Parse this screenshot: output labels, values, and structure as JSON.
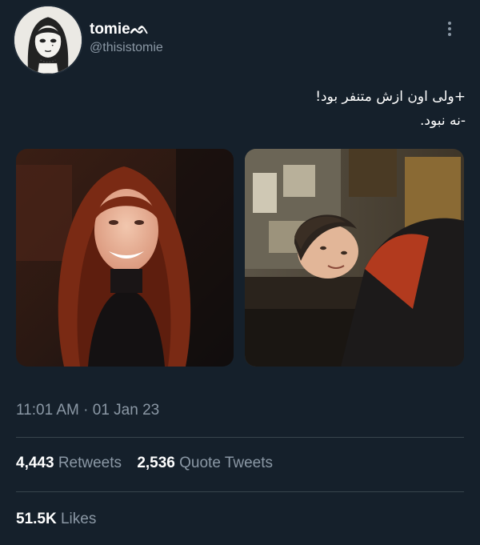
{
  "author": {
    "display_name": "tomie",
    "name_glyph": "ᨒ",
    "handle": "@thisistomie",
    "avatar_icon": "manga-portrait-avatar"
  },
  "tweet": {
    "lines": [
      "+ولی اون ازش متنفر بود!",
      "-نه نبود."
    ]
  },
  "media": [
    {
      "icon": "photo-woman-red-hair-smiling"
    },
    {
      "icon": "photo-man-leaning-on-desk"
    }
  ],
  "meta": {
    "time": "11:01 AM",
    "separator": "·",
    "date": "01 Jan 23"
  },
  "stats": {
    "retweets_count": "4,443",
    "retweets_label": "Retweets",
    "quotes_count": "2,536",
    "quotes_label": "Quote Tweets",
    "likes_count": "51.5K",
    "likes_label": "Likes"
  },
  "colors": {
    "background": "#15202b",
    "secondary_text": "#8b98a5",
    "divider": "#38444d"
  }
}
